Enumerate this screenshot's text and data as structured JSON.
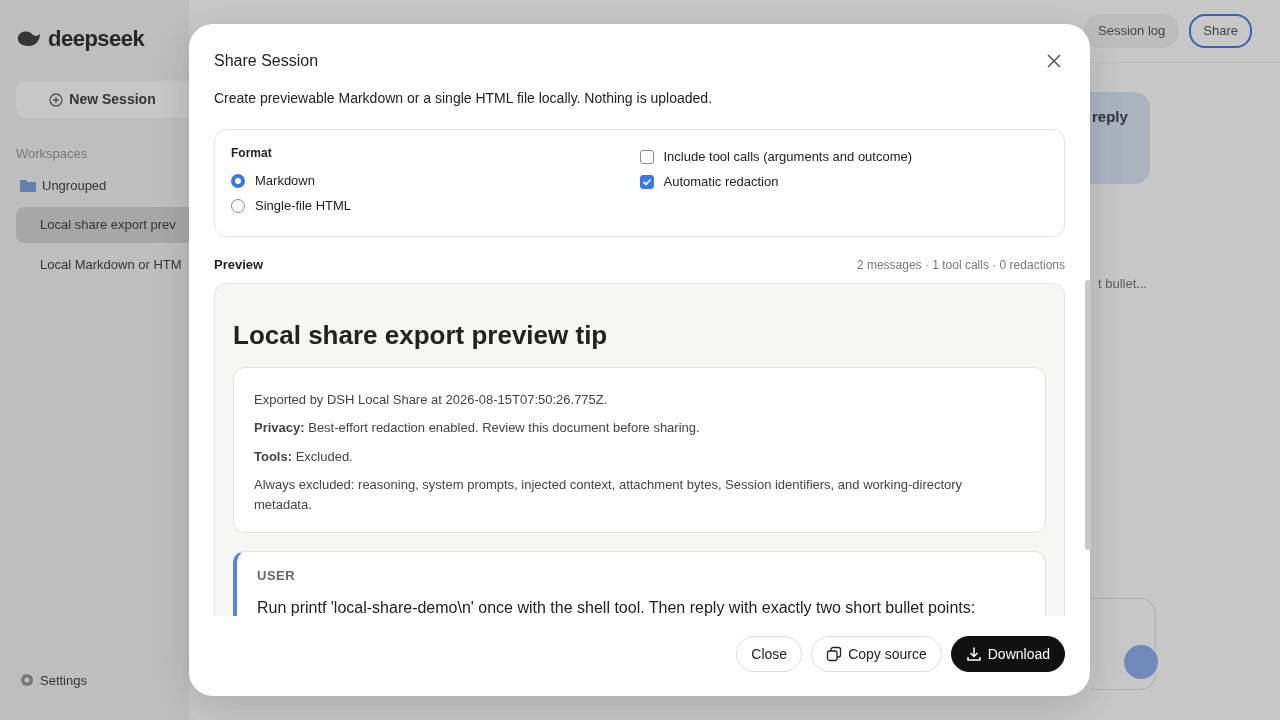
{
  "background": {
    "logo": "deepseek",
    "new_session": "New Session",
    "workspaces_label": "Workspaces",
    "sidebar_items": [
      {
        "label": "Ungrouped",
        "kind": "folder",
        "selected": false
      },
      {
        "label": "Local share export prev",
        "kind": "session",
        "selected": true
      },
      {
        "label": "Local Markdown or HTM",
        "kind": "session",
        "selected": false
      }
    ],
    "settings": "Settings",
    "header_buttons": [
      {
        "label": "Session log",
        "kind": "plain"
      },
      {
        "label": "Share",
        "kind": "outlined"
      }
    ],
    "reply_fragment": "reply",
    "message_fragment": "t bullet..."
  },
  "dialog": {
    "title": "Share Session",
    "description": "Create previewable Markdown or a single HTML file locally. Nothing is uploaded.",
    "format": {
      "label": "Format",
      "options": [
        {
          "label": "Markdown",
          "selected": true
        },
        {
          "label": "Single-file HTML",
          "selected": false
        }
      ]
    },
    "options": [
      {
        "label": "Include tool calls (arguments and outcome)",
        "checked": false
      },
      {
        "label": "Automatic redaction",
        "checked": true
      }
    ],
    "preview": {
      "label": "Preview",
      "stats": "2 messages · 1 tool calls · 0 redactions",
      "heading": "Local share export preview tip",
      "meta": [
        "Exported by DSH Local Share at 2026-08-15T07:50:26.775Z.",
        "**Privacy:** Best-effort redaction enabled. Review this document before sharing.",
        "**Tools:** Excluded.",
        "Always excluded: reasoning, system prompts, injected context, attachment bytes, Session identifiers, and working-directory metadata."
      ],
      "messages": [
        {
          "role": "USER",
          "text": "Run printf 'local-share-demo\\n' once with the shell tool. Then reply with exactly two short bullet points:"
        }
      ]
    },
    "buttons": [
      {
        "label": "Close",
        "kind": "outline"
      },
      {
        "label": "Copy source",
        "kind": "outline"
      },
      {
        "label": "Download",
        "kind": "primary"
      }
    ]
  }
}
